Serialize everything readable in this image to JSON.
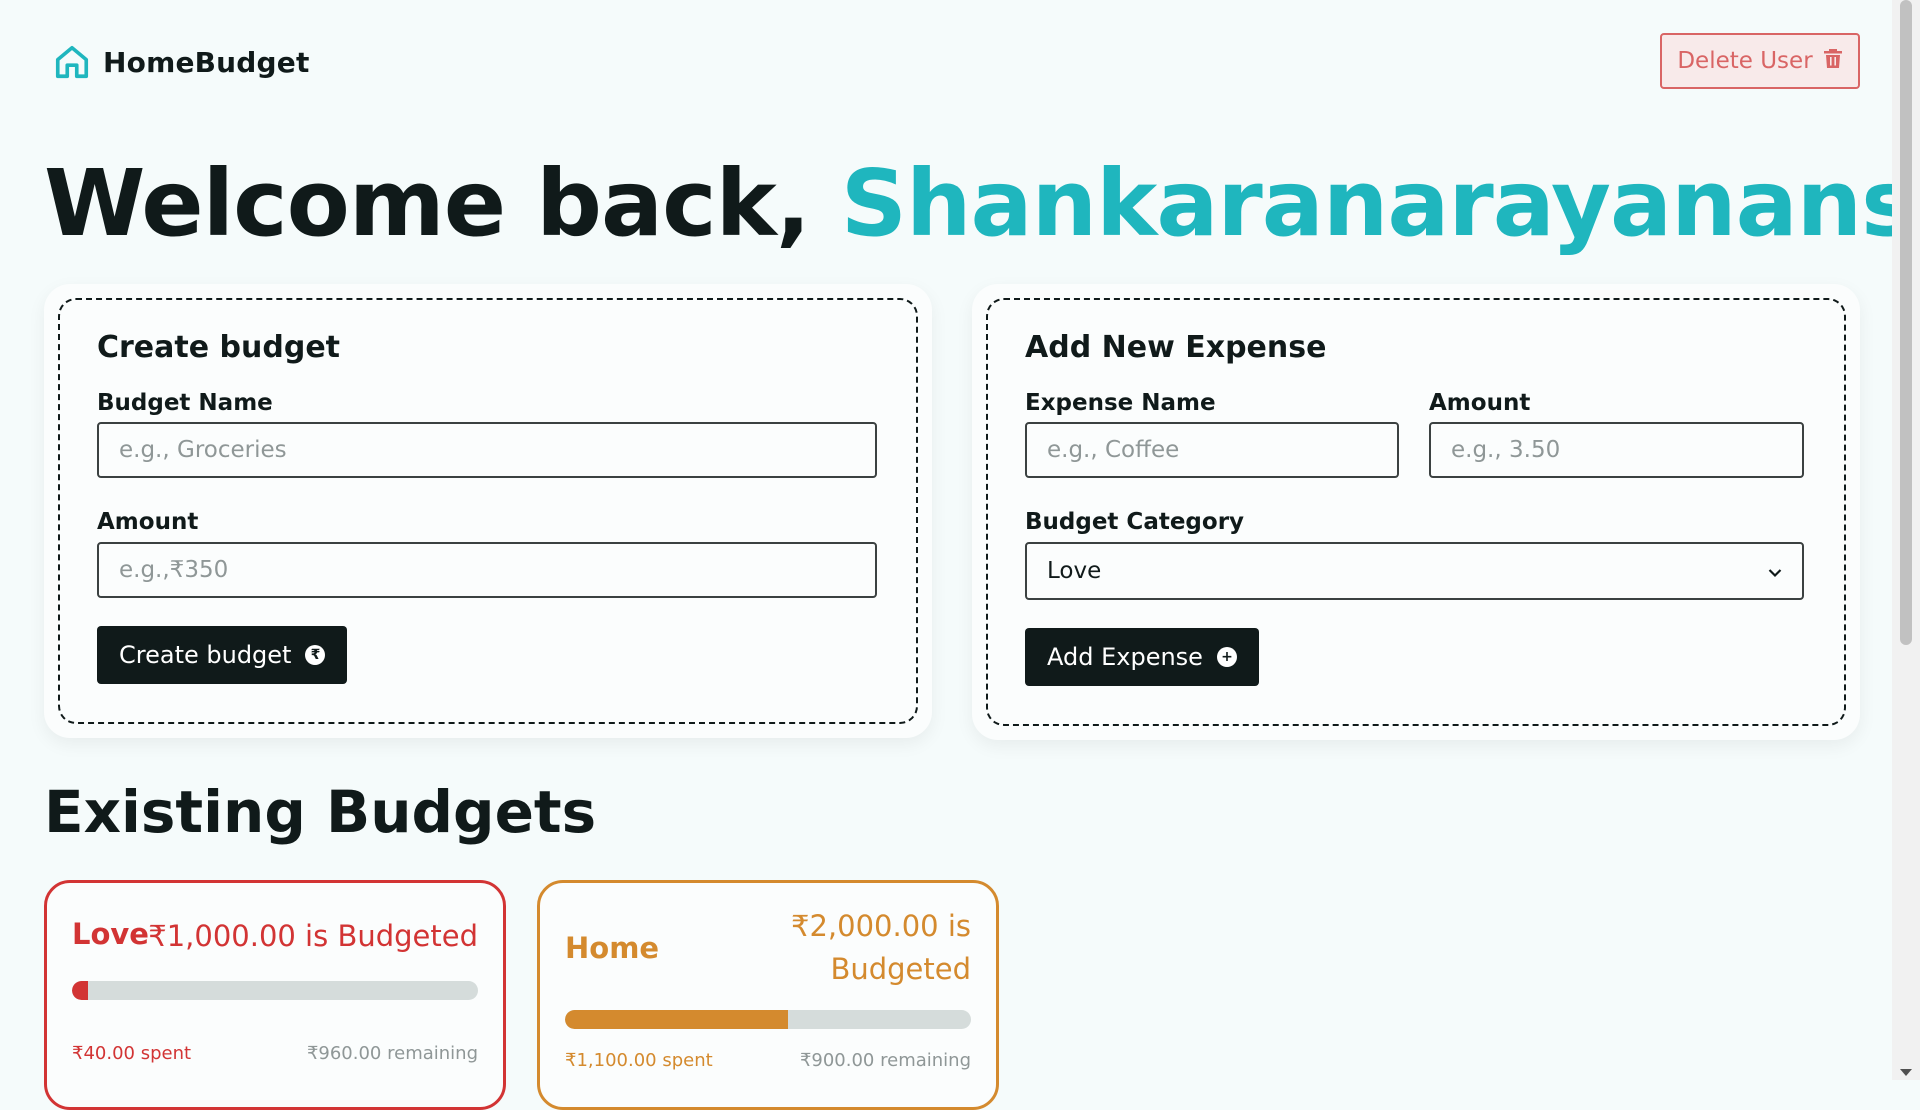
{
  "header": {
    "brand": "HomeBudget",
    "delete_label": "Delete User"
  },
  "welcome": {
    "prefix": "Welcome back, ",
    "username": "Shankaranarayanansk"
  },
  "create_budget": {
    "title": "Create budget",
    "name_label": "Budget Name",
    "name_placeholder": "e.g., Groceries",
    "amount_label": "Amount",
    "amount_placeholder": "e.g.,₹350",
    "submit_label": "Create budget",
    "submit_icon": "₹"
  },
  "add_expense": {
    "title": "Add New Expense",
    "name_label": "Expense Name",
    "name_placeholder": "e.g., Coffee",
    "amount_label": "Amount",
    "amount_placeholder": "e.g., 3.50",
    "category_label": "Budget Category",
    "category_value": "Love",
    "submit_label": "Add Expense",
    "submit_icon": "+"
  },
  "existing": {
    "title": "Existing Budgets",
    "budgets": [
      {
        "name": "Love",
        "budgeted": "₹1,000.00 is Budgeted",
        "spent": "₹40.00 spent",
        "remaining": "₹960.00 remaining",
        "progress": 0.04,
        "color": "#d23434"
      },
      {
        "name": "Home",
        "budgeted_line1": "₹2,000.00 is",
        "budgeted_line2": "Budgeted",
        "spent": "₹1,100.00 spent",
        "remaining": "₹900.00 remaining",
        "progress": 0.55,
        "color": "#d48a2e"
      }
    ]
  },
  "colors": {
    "accent": "#1fb6be",
    "danger": "#d96565",
    "dark": "#101a1a"
  }
}
